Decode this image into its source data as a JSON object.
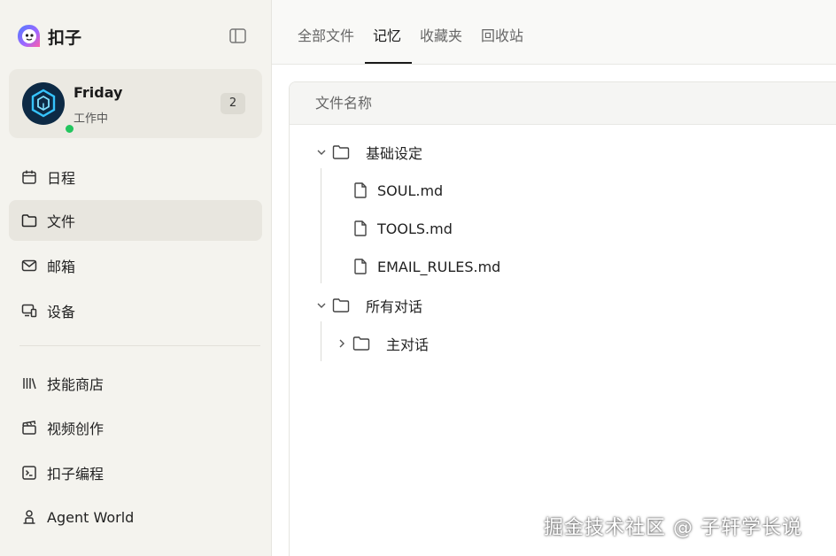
{
  "brand": {
    "name": "扣子"
  },
  "agent": {
    "name": "Friday",
    "status": "工作中",
    "badge": "2",
    "status_color": "#22c55e"
  },
  "sidebar": {
    "items": [
      {
        "label": "日程",
        "icon": "calendar-icon"
      },
      {
        "label": "文件",
        "icon": "folder-icon",
        "active": true
      },
      {
        "label": "邮箱",
        "icon": "mail-icon"
      },
      {
        "label": "设备",
        "icon": "device-icon"
      },
      {
        "label": "技能商店",
        "icon": "library-icon"
      },
      {
        "label": "视频创作",
        "icon": "clapperboard-icon"
      },
      {
        "label": "扣子编程",
        "icon": "terminal-icon"
      },
      {
        "label": "Agent World",
        "icon": "person-stand-icon"
      }
    ]
  },
  "tabs": [
    {
      "label": "全部文件"
    },
    {
      "label": "记忆",
      "active": true
    },
    {
      "label": "收藏夹"
    },
    {
      "label": "回收站"
    }
  ],
  "file_table": {
    "header": "文件名称"
  },
  "tree": {
    "folders": [
      {
        "name": "基础设定",
        "expanded": true,
        "files": [
          "SOUL.md",
          "TOOLS.md",
          "EMAIL_RULES.md"
        ]
      },
      {
        "name": "所有对话",
        "expanded": true,
        "subfolders": [
          {
            "name": "主对话",
            "expanded": false
          }
        ]
      }
    ]
  },
  "watermark": "掘金技术社区 @ 子轩学长说"
}
